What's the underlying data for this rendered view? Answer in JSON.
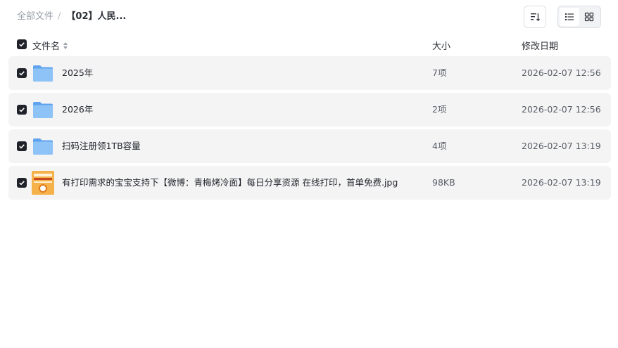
{
  "breadcrumb": {
    "root": "全部文件",
    "separator": "/",
    "current": "【02】人民..."
  },
  "toolbar": {
    "sort_icon": "sort-icon",
    "list_view_icon": "list-view-icon",
    "grid_view_icon": "grid-view-icon",
    "active_view": "list"
  },
  "table": {
    "headers": {
      "name": "文件名",
      "size": "大小",
      "modified": "修改日期"
    },
    "rows": [
      {
        "name": "2025年",
        "size": "7项",
        "date": "2026-02-07 12:56",
        "type": "folder",
        "checked": true
      },
      {
        "name": "2026年",
        "size": "2项",
        "date": "2026-02-07 12:56",
        "type": "folder",
        "checked": true
      },
      {
        "name": "扫码注册领1TB容量",
        "size": "4项",
        "date": "2026-02-07 13:19",
        "type": "folder",
        "checked": true
      },
      {
        "name": "有打印需求的宝宝支持下【微博：青梅烤冷面】每日分享资源 在线打印，首单免费.jpg",
        "size": "98KB",
        "date": "2026-02-07 13:19",
        "type": "image",
        "checked": true
      }
    ]
  },
  "colors": {
    "row_bg": "#f4f4f5",
    "checkbox": "#1f2329",
    "folder": "#7cb6f5",
    "image_thumb": "#f6b24a"
  }
}
